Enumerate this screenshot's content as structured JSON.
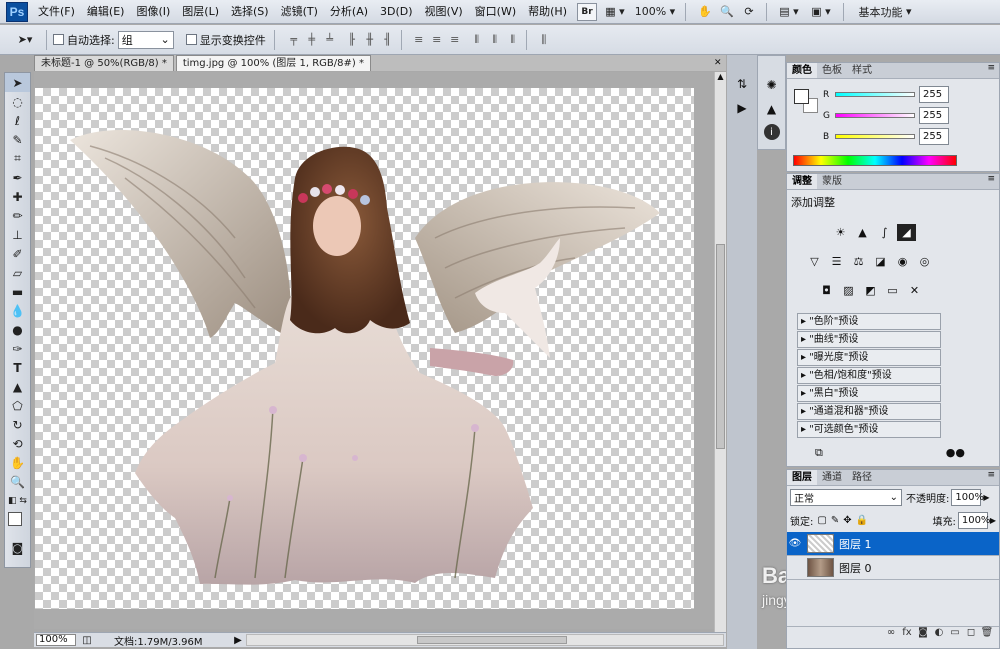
{
  "app": {
    "logo": "Ps"
  },
  "menu": [
    "文件(F)",
    "编辑(E)",
    "图像(I)",
    "图层(L)",
    "选择(S)",
    "滤镜(T)",
    "分析(A)",
    "3D(D)",
    "视图(V)",
    "窗口(W)",
    "帮助(H)"
  ],
  "menubar_right": {
    "br_label": "Br",
    "zoom": "100%",
    "workspace": "基本功能"
  },
  "options": {
    "auto_select_label": "自动选择:",
    "auto_select_value": "组",
    "show_transform_label": "显示变换控件"
  },
  "tabs": [
    {
      "label": "未标题-1 @ 50%(RGB/8) *"
    },
    {
      "label": "timg.jpg @ 100% (图层 1, RGB/8#) *"
    }
  ],
  "status": {
    "zoom": "100%",
    "doc": "文档:1.79M/3.96M"
  },
  "color_panel": {
    "tabs": [
      "颜色",
      "色板",
      "样式"
    ],
    "r_label": "R",
    "g_label": "G",
    "b_label": "B",
    "r": "255",
    "g": "255",
    "b": "255"
  },
  "adjust_panel": {
    "tabs": [
      "调整",
      "蒙版"
    ],
    "title": "添加调整",
    "presets": [
      "\"色阶\"预设",
      "\"曲线\"预设",
      "\"曝光度\"预设",
      "\"色相/饱和度\"预设",
      "\"黑白\"预设",
      "\"通道混和器\"预设",
      "\"可选颜色\"预设"
    ]
  },
  "layers_panel": {
    "tabs": [
      "图层",
      "通道",
      "路径"
    ],
    "blend": "正常",
    "opacity_label": "不透明度:",
    "opacity": "100%",
    "lock_label": "锁定:",
    "fill_label": "填充:",
    "fill": "100%",
    "layers": [
      {
        "name": "图层 1"
      },
      {
        "name": "图层 0"
      }
    ]
  },
  "watermark": {
    "text": "Bai 经验",
    "url": "jingyan.baidu.com"
  },
  "colors": {
    "accent": "#0a64c8",
    "ps_blue": "#0a4f9f"
  }
}
